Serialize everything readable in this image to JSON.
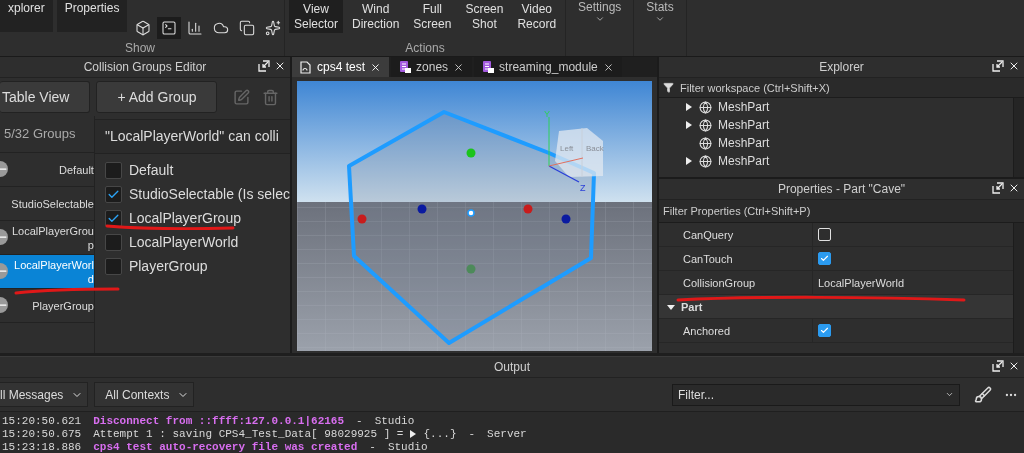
{
  "ribbon": {
    "show": {
      "label": "Show",
      "buttons": [
        {
          "label": "xplorer"
        },
        {
          "label": "Properties"
        }
      ],
      "tools": [
        {
          "kind": "cube",
          "selected": false
        },
        {
          "kind": "terminal",
          "selected": true
        },
        {
          "kind": "chart",
          "selected": false
        },
        {
          "kind": "cloud",
          "selected": false
        },
        {
          "kind": "windows",
          "selected": false
        },
        {
          "kind": "sparkle",
          "selected": false
        }
      ]
    },
    "actions": {
      "label": "Actions",
      "buttons": [
        {
          "label": "View Selector",
          "selected": true
        },
        {
          "label": "Wind Direction",
          "selected": false
        },
        {
          "label": "Full Screen",
          "selected": false
        },
        {
          "label": "Screen Shot",
          "selected": false
        },
        {
          "label": "Video Record",
          "selected": false
        }
      ]
    },
    "dropdowns": [
      {
        "label": "Settings"
      },
      {
        "label": "Stats"
      }
    ]
  },
  "collision_editor": {
    "title": "Collision Groups Editor",
    "buttons": [
      {
        "label": "Table View"
      },
      {
        "label": "+ Add Group"
      }
    ],
    "count": "5/32 Groups",
    "heading": "\"LocalPlayerWorld\" can colli",
    "groups": [
      {
        "name": "Default",
        "selected": false
      },
      {
        "name": "StudioSelectable",
        "selected": false
      },
      {
        "name": "LocalPlayerGroup",
        "selected": false
      },
      {
        "name": "LocalPlayerWorld",
        "selected": true
      },
      {
        "name": "PlayerGroup",
        "selected": false
      }
    ],
    "collides_with": [
      {
        "label": "Default",
        "checked": false
      },
      {
        "label": "StudioSelectable (Is selec",
        "checked": true
      },
      {
        "label": "LocalPlayerGroup",
        "checked": true
      },
      {
        "label": "LocalPlayerWorld",
        "checked": false
      },
      {
        "label": "PlayerGroup",
        "checked": false
      }
    ]
  },
  "viewport": {
    "tabs": [
      {
        "label": "cps4 test",
        "kind": "place",
        "selected": true
      },
      {
        "label": "zones",
        "kind": "script",
        "selected": false
      },
      {
        "label": "streaming_module",
        "kind": "script",
        "selected": false
      }
    ],
    "cube_faces": [
      "Left",
      "Back"
    ],
    "axes": [
      "Y",
      "Z"
    ]
  },
  "explorer": {
    "title": "Explorer",
    "filter_placeholder": "Filter workspace (Ctrl+Shift+X)",
    "items": [
      {
        "name": "MeshPart",
        "has_children": true
      },
      {
        "name": "MeshPart",
        "has_children": true
      },
      {
        "name": "MeshPart",
        "has_children": false
      },
      {
        "name": "MeshPart",
        "has_children": true
      }
    ]
  },
  "properties": {
    "title": "Properties - Part \"Cave\"",
    "filter_placeholder": "Filter Properties (Ctrl+Shift+P)",
    "rows": [
      {
        "kind": "bool",
        "name": "CanQuery",
        "checked": false
      },
      {
        "kind": "bool",
        "name": "CanTouch",
        "checked": true
      },
      {
        "kind": "text",
        "name": "CollisionGroup",
        "value": "LocalPlayerWorld"
      },
      {
        "kind": "category",
        "name": "Part",
        "expanded": true
      },
      {
        "kind": "bool",
        "name": "Anchored",
        "checked": true
      }
    ]
  },
  "output": {
    "title": "Output",
    "message_filter": "ll Messages",
    "context_filter": "All Contexts",
    "filter_placeholder": "Filter...",
    "lines": [
      {
        "time": "15:20:50.621",
        "kind": "highlight",
        "message": "Disconnect from ::ffff:127.0.0.1|62165",
        "separator": "-",
        "source": "Studio"
      },
      {
        "time": "15:20:50.675",
        "kind": "plain",
        "message": "Attempt 1 : saving CPS4_Test_Data[ 98029925 ] =",
        "table": "{...}",
        "separator": "-",
        "source": "Server"
      },
      {
        "time": "15:23:18.886",
        "kind": "highlight",
        "message": "cps4 test auto-recovery file was created",
        "separator": "-",
        "source": "Studio"
      }
    ]
  }
}
